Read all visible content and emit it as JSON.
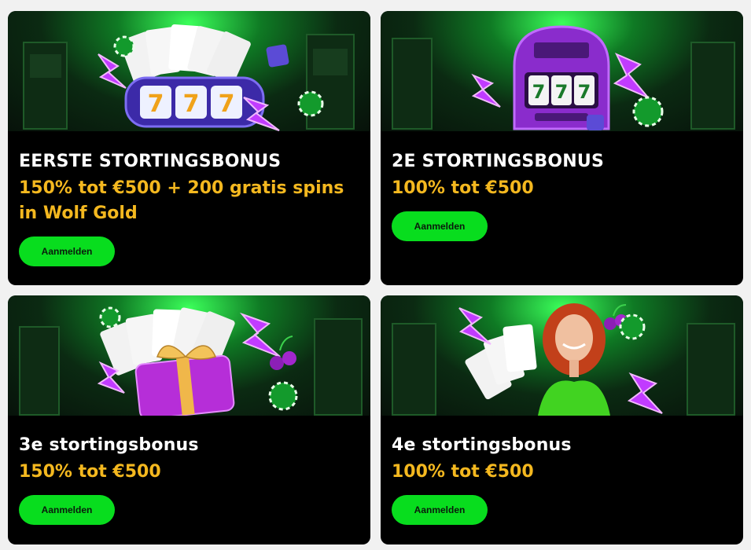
{
  "cards": [
    {
      "title": "EERSTE STORTINGSBONUS",
      "offer": "150% tot €500 + 200 gratis spins in Wolf Gold",
      "button_label": "Aanmelden",
      "banner_icons": [
        "lightning-icon",
        "playing-cards",
        "slot-reels-777",
        "casino-chip-icon",
        "dice-icon"
      ]
    },
    {
      "title": "2E STORTINGSBONUS",
      "offer": "100% tot €500",
      "button_label": "Aanmelden",
      "banner_icons": [
        "lightning-icon",
        "slot-machine-777",
        "casino-chip-icon",
        "dice-icon"
      ]
    },
    {
      "title": "3e stortingsbonus",
      "offer": "150% tot €500",
      "button_label": "Aanmelden",
      "banner_icons": [
        "lightning-icon",
        "playing-cards",
        "gift-box",
        "cherries-icon",
        "casino-chip-icon"
      ]
    },
    {
      "title": "4e stortingsbonus",
      "offer": "100% tot €500",
      "button_label": "Aanmelden",
      "banner_icons": [
        "lightning-icon",
        "playing-cards",
        "woman-illustration",
        "cherries-icon",
        "casino-chip-icon"
      ]
    }
  ],
  "colors": {
    "card_bg": "#000000",
    "title": "#ffffff",
    "offer": "#f4b81f",
    "button": "#08dd1e",
    "button_text": "#0a1a0c",
    "page_bg": "#f1f1f1"
  }
}
